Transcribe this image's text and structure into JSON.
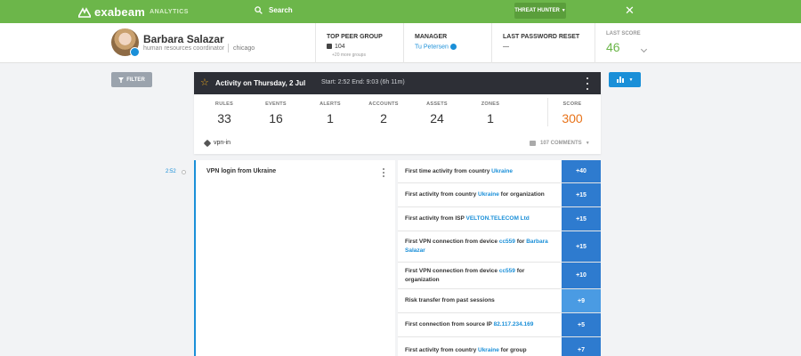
{
  "topbar": {
    "logo_text": "exabeam",
    "logo_sub": "ANALYTICS",
    "search_label": "Search",
    "threat_hunter_label": "THREAT HUNTER",
    "close_glyph": "✕",
    "bg_color": "#6cb64a"
  },
  "profile": {
    "name": "Barbara Salazar",
    "role": "human resources coordinator",
    "location": "chicago",
    "top_peer_group": {
      "label": "TOP PEER GROUP",
      "value": "104",
      "more": "+20 more groups"
    },
    "manager": {
      "label": "MANAGER",
      "value": "Tu Petersen"
    },
    "last_password_reset": {
      "label": "LAST PASSWORD RESET",
      "value": "—"
    },
    "last_score": {
      "label": "LAST SCORE",
      "value": "46"
    }
  },
  "filter": {
    "label": "FILTER"
  },
  "activity": {
    "title": "Activity on Thursday, 2 Jul",
    "time": "Start: 2:52  End: 9:03 (6h 11m)",
    "stats": [
      {
        "label": "RULES",
        "value": "33"
      },
      {
        "label": "EVENTS",
        "value": "16"
      },
      {
        "label": "ALERTS",
        "value": "1"
      },
      {
        "label": "ACCOUNTS",
        "value": "2"
      },
      {
        "label": "ASSETS",
        "value": "24"
      },
      {
        "label": "ZONES",
        "value": "1"
      },
      {
        "label": "SCORE",
        "value": "300"
      }
    ],
    "tag": "vpn-in",
    "comments": "107 COMMENTS"
  },
  "timeline": {
    "time": "2:52",
    "event_title": "VPN login from Ukraine"
  },
  "rules": [
    {
      "parts": [
        "First time activity from country ",
        "Ukraine"
      ],
      "score": "+40"
    },
    {
      "parts": [
        "First activity from country ",
        "Ukraine",
        " for organization"
      ],
      "score": "+15"
    },
    {
      "parts": [
        "First activity from ISP ",
        "VELTON.TELECOM Ltd"
      ],
      "score": "+15"
    },
    {
      "parts": [
        "First VPN connection from device ",
        "cc559",
        " for ",
        "Barbara Salazar"
      ],
      "score": "+15"
    },
    {
      "parts": [
        "First VPN connection from device ",
        "cc559",
        " for organization"
      ],
      "score": "+10"
    },
    {
      "parts": [
        "Risk transfer from past sessions"
      ],
      "score": "+9"
    },
    {
      "parts": [
        "First connection from source IP ",
        "82.117.234.169"
      ],
      "score": "+5"
    },
    {
      "parts": [
        "First activity from country ",
        "Ukraine",
        " for group"
      ],
      "score": "+7"
    }
  ]
}
